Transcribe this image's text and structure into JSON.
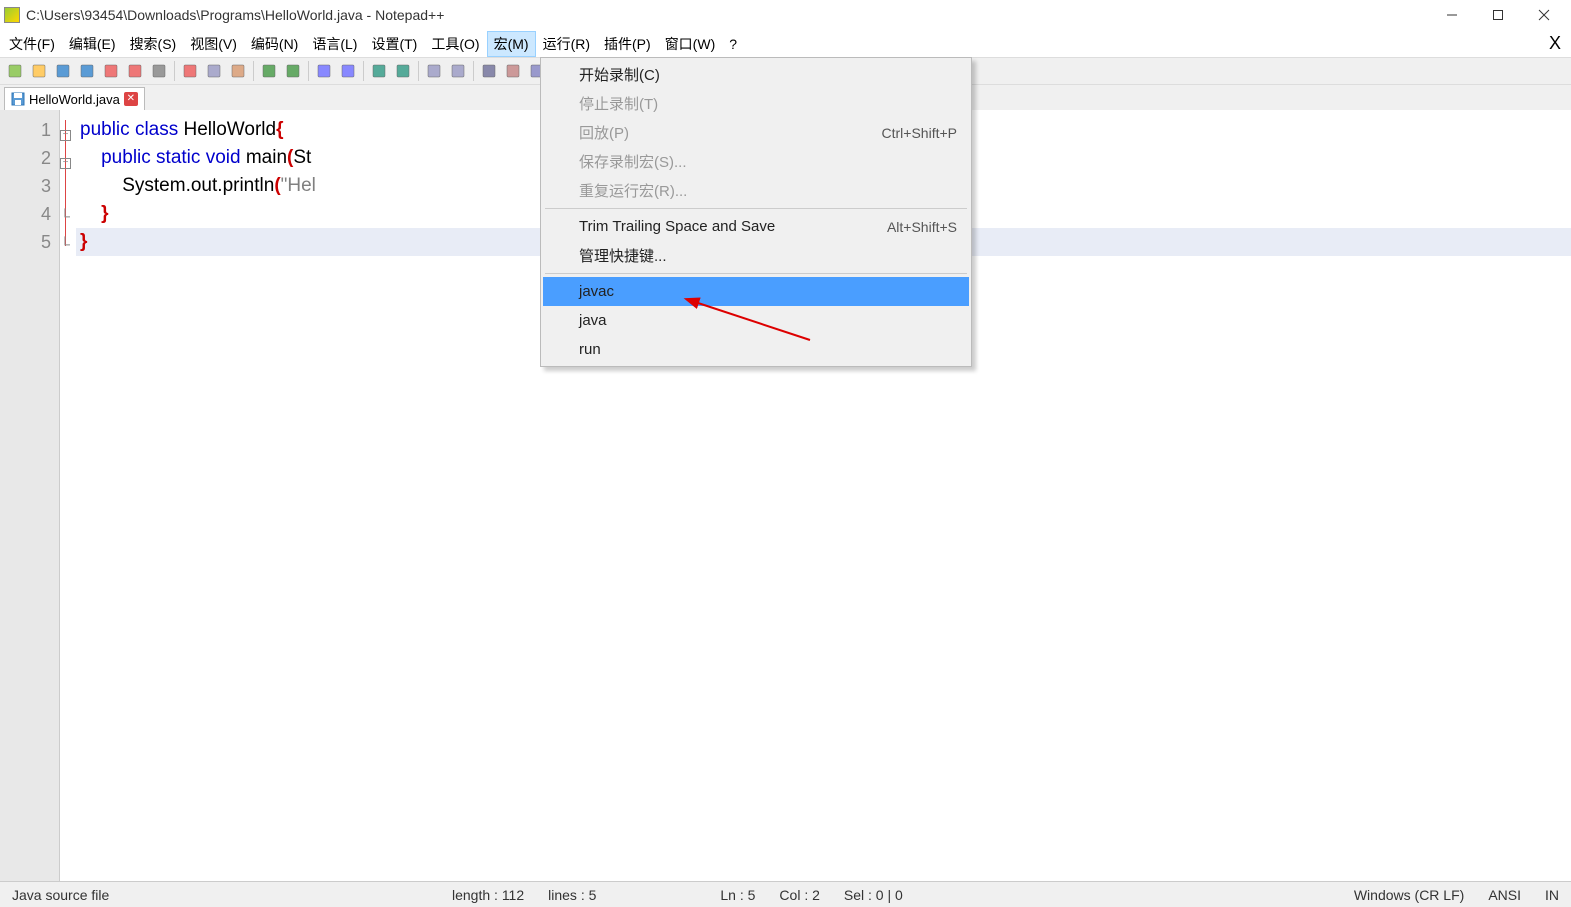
{
  "window": {
    "title": "C:\\Users\\93454\\Downloads\\Programs\\HelloWorld.java - Notepad++"
  },
  "menubar": {
    "items": [
      "文件(F)",
      "编辑(E)",
      "搜索(S)",
      "视图(V)",
      "编码(N)",
      "语言(L)",
      "设置(T)",
      "工具(O)",
      "宏(M)",
      "运行(R)",
      "插件(P)",
      "窗口(W)",
      "?"
    ],
    "active_index": 8,
    "extra_close": "X"
  },
  "toolbar_icons": [
    "new-file",
    "open-file",
    "save-file",
    "save-all",
    "close-file",
    "close-all",
    "print",
    "",
    "cut",
    "copy",
    "paste",
    "",
    "undo",
    "redo",
    "",
    "find",
    "replace",
    "",
    "zoom-in",
    "zoom-out",
    "",
    "sync-v",
    "sync-h",
    "",
    "word-wrap",
    "show-all",
    "indent-guide",
    "",
    "folder",
    "doc-list",
    "doc-map",
    "func-list",
    "",
    "record-macro",
    "play-macro"
  ],
  "tab": {
    "label": "HelloWorld.java"
  },
  "code": {
    "lines": [
      {
        "n": "1",
        "frag": [
          {
            "t": "public",
            "c": "kw"
          },
          {
            "t": " ",
            "c": ""
          },
          {
            "t": "class",
            "c": "kw"
          },
          {
            "t": " HelloWorld",
            "c": "ident"
          },
          {
            "t": "{",
            "c": "brace"
          }
        ]
      },
      {
        "n": "2",
        "frag": [
          {
            "t": "    public",
            "c": "kw"
          },
          {
            "t": " ",
            "c": ""
          },
          {
            "t": "static",
            "c": "kw"
          },
          {
            "t": " ",
            "c": ""
          },
          {
            "t": "void",
            "c": "kw"
          },
          {
            "t": " main",
            "c": "ident"
          },
          {
            "t": "(",
            "c": "brace"
          },
          {
            "t": "St",
            "c": "ident"
          }
        ]
      },
      {
        "n": "3",
        "frag": [
          {
            "t": "        System",
            "c": "ident"
          },
          {
            "t": ".",
            "c": ""
          },
          {
            "t": "out",
            "c": "ident"
          },
          {
            "t": ".",
            "c": ""
          },
          {
            "t": "println",
            "c": "ident"
          },
          {
            "t": "(",
            "c": "brace"
          },
          {
            "t": "\"Hel",
            "c": "str"
          }
        ]
      },
      {
        "n": "4",
        "frag": [
          {
            "t": "    ",
            "c": ""
          },
          {
            "t": "}",
            "c": "brace"
          }
        ]
      },
      {
        "n": "5",
        "frag": [
          {
            "t": "}",
            "c": "brace"
          }
        ]
      }
    ],
    "current_line_index": 4
  },
  "dropdown": {
    "items": [
      {
        "label": "开始录制(C)",
        "disabled": false
      },
      {
        "label": "停止录制(T)",
        "disabled": true
      },
      {
        "label": "回放(P)",
        "disabled": true,
        "shortcut": "Ctrl+Shift+P"
      },
      {
        "label": "保存录制宏(S)...",
        "disabled": true
      },
      {
        "label": "重复运行宏(R)...",
        "disabled": true
      },
      {
        "sep": true
      },
      {
        "label": "Trim Trailing Space and Save",
        "shortcut": "Alt+Shift+S"
      },
      {
        "label": "管理快捷键..."
      },
      {
        "sep": true
      },
      {
        "label": "javac",
        "highlighted": true
      },
      {
        "label": "java"
      },
      {
        "label": "run"
      }
    ]
  },
  "statusbar": {
    "file_type": "Java source file",
    "length": "length : 112",
    "lines": "lines : 5",
    "ln": "Ln : 5",
    "col": "Col : 2",
    "sel": "Sel : 0 | 0",
    "eol": "Windows (CR LF)",
    "encoding": "ANSI",
    "mode": "IN"
  }
}
